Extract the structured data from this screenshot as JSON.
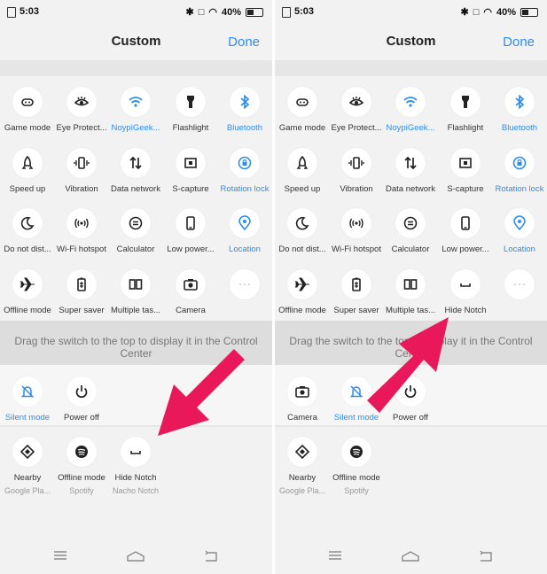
{
  "accent_color": "#2d8cf0",
  "arrow_color": "#e8185a",
  "status": {
    "time": "5:03",
    "battery": "40%"
  },
  "header": {
    "title": "Custom",
    "done": "Done"
  },
  "left": {
    "top_tiles": [
      {
        "label": "Game mode",
        "icon": "gamepad-icon",
        "active": false
      },
      {
        "label": "Eye Protect...",
        "icon": "eye-icon",
        "active": false
      },
      {
        "label": "NoypiGeek...",
        "icon": "wifi-icon",
        "active": true
      },
      {
        "label": "Flashlight",
        "icon": "flashlight-icon",
        "active": false
      },
      {
        "label": "Bluetooth",
        "icon": "bluetooth-icon",
        "active": true
      },
      {
        "label": "Speed up",
        "icon": "rocket-icon",
        "active": false
      },
      {
        "label": "Vibration",
        "icon": "vibration-icon",
        "active": false
      },
      {
        "label": "Data network",
        "icon": "data-network-icon",
        "active": false
      },
      {
        "label": "S-capture",
        "icon": "screenshot-icon",
        "active": false
      },
      {
        "label": "Rotation lock",
        "icon": "rotation-lock-icon",
        "active": true
      },
      {
        "label": "Do not dist...",
        "icon": "moon-icon",
        "active": false
      },
      {
        "label": "Wi-Fi hotspot",
        "icon": "hotspot-icon",
        "active": false
      },
      {
        "label": "Calculator",
        "icon": "calculator-icon",
        "active": false
      },
      {
        "label": "Low power...",
        "icon": "phone-icon",
        "active": false
      },
      {
        "label": "Location",
        "icon": "location-icon",
        "active": true
      },
      {
        "label": "Offline mode",
        "icon": "airplane-icon",
        "active": false
      },
      {
        "label": "Super saver",
        "icon": "battery-saver-icon",
        "active": false
      },
      {
        "label": "Multiple tas...",
        "icon": "multitask-icon",
        "active": false
      },
      {
        "label": "Camera",
        "icon": "camera-icon",
        "active": false
      },
      {
        "label": "",
        "icon": "more-icon",
        "active": false
      }
    ],
    "drag_hint": "Drag the switch to the top to display it in the Control Center",
    "bottom_tiles": [
      {
        "label": "Silent mode",
        "icon": "silent-icon",
        "active": true,
        "sub": ""
      },
      {
        "label": "Power off",
        "icon": "power-icon",
        "active": false,
        "sub": ""
      }
    ],
    "extra_tiles": [
      {
        "label": "Nearby",
        "icon": "nearby-icon",
        "active": false,
        "sub": "Google Pla..."
      },
      {
        "label": "Offline mode",
        "icon": "spotify-icon",
        "active": false,
        "sub": "Spotify"
      },
      {
        "label": "Hide Notch",
        "icon": "notch-icon",
        "active": false,
        "sub": "Nacho Notch"
      }
    ]
  },
  "right": {
    "top_tiles": [
      {
        "label": "Game mode",
        "icon": "gamepad-icon",
        "active": false
      },
      {
        "label": "Eye Protect...",
        "icon": "eye-icon",
        "active": false
      },
      {
        "label": "NoypiGeek...",
        "icon": "wifi-icon",
        "active": true
      },
      {
        "label": "Flashlight",
        "icon": "flashlight-icon",
        "active": false
      },
      {
        "label": "Bluetooth",
        "icon": "bluetooth-icon",
        "active": true
      },
      {
        "label": "Speed up",
        "icon": "rocket-icon",
        "active": false
      },
      {
        "label": "Vibration",
        "icon": "vibration-icon",
        "active": false
      },
      {
        "label": "Data network",
        "icon": "data-network-icon",
        "active": false
      },
      {
        "label": "S-capture",
        "icon": "screenshot-icon",
        "active": false
      },
      {
        "label": "Rotation lock",
        "icon": "rotation-lock-icon",
        "active": true
      },
      {
        "label": "Do not dist...",
        "icon": "moon-icon",
        "active": false
      },
      {
        "label": "Wi-Fi hotspot",
        "icon": "hotspot-icon",
        "active": false
      },
      {
        "label": "Calculator",
        "icon": "calculator-icon",
        "active": false
      },
      {
        "label": "Low power...",
        "icon": "phone-icon",
        "active": false
      },
      {
        "label": "Location",
        "icon": "location-icon",
        "active": true
      },
      {
        "label": "Offline mode",
        "icon": "airplane-icon",
        "active": false
      },
      {
        "label": "Super saver",
        "icon": "battery-saver-icon",
        "active": false
      },
      {
        "label": "Multiple tas...",
        "icon": "multitask-icon",
        "active": false
      },
      {
        "label": "Hide Notch",
        "icon": "notch-icon",
        "active": false
      },
      {
        "label": "",
        "icon": "more-icon",
        "active": false
      }
    ],
    "drag_hint": "Drag the switch to the top to display it in the Control Center",
    "bottom_tiles": [
      {
        "label": "Camera",
        "icon": "camera-icon",
        "active": false,
        "sub": ""
      },
      {
        "label": "Silent mode",
        "icon": "silent-icon",
        "active": true,
        "sub": ""
      },
      {
        "label": "Power off",
        "icon": "power-icon",
        "active": false,
        "sub": ""
      }
    ],
    "extra_tiles": [
      {
        "label": "Nearby",
        "icon": "nearby-icon",
        "active": false,
        "sub": "Google Pla..."
      },
      {
        "label": "Offline mode",
        "icon": "spotify-icon",
        "active": false,
        "sub": "Spotify"
      }
    ]
  }
}
